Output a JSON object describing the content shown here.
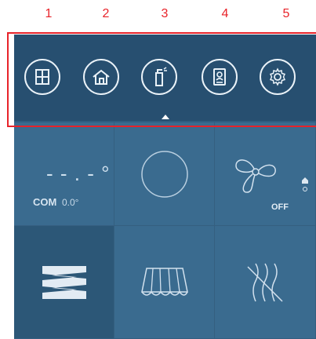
{
  "step_numbers": [
    "1",
    "2",
    "3",
    "4",
    "5"
  ],
  "nav": {
    "items": [
      {
        "icon": "window-grid-icon"
      },
      {
        "icon": "house-icon"
      },
      {
        "icon": "spray-bottle-icon"
      },
      {
        "icon": "intercom-icon"
      },
      {
        "icon": "gear-icon"
      }
    ],
    "selected_index": 2
  },
  "climate": {
    "temperature": "- - . - °",
    "com_label": "COM",
    "com_value": "0.0°"
  },
  "fan": {
    "state": "OFF"
  },
  "colors": {
    "panel": "#2f5d80",
    "topbar": "#274f70",
    "tile": "#3a6b8f",
    "highlight": "#e8232a"
  }
}
